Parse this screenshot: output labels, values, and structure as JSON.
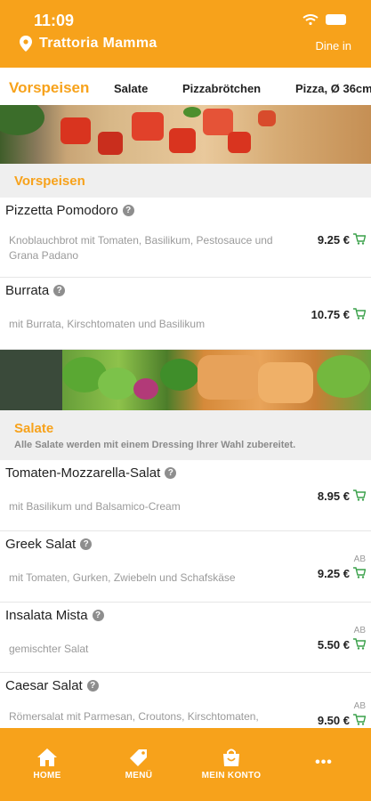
{
  "status_bar": {
    "time": "11:09"
  },
  "header": {
    "restaurant_name": "Trattoria Mamma",
    "mode": "Dine in"
  },
  "tabs": [
    {
      "label": "Vorspeisen",
      "active": true
    },
    {
      "label": "Salate",
      "active": false
    },
    {
      "label": "Pizzabrötchen",
      "active": false
    },
    {
      "label": "Pizza, Ø 36cm",
      "active": false
    }
  ],
  "sections": [
    {
      "title": "Vorspeisen",
      "note": "",
      "items": [
        {
          "name": "Pizzetta Pomodoro",
          "description": "Knoblauchbrot mit Tomaten, Basilikum, Pestosauce und Grana Padano",
          "price": "9.25 €",
          "ab": ""
        },
        {
          "name": "Burrata",
          "description": "mit Burrata, Kirschtomaten und Basilikum",
          "price": "10.75 €",
          "ab": ""
        }
      ]
    },
    {
      "title": "Salate",
      "note": "Alle Salate werden mit einem Dressing Ihrer Wahl zubereitet.",
      "items": [
        {
          "name": "Tomaten-Mozzarella-Salat",
          "description": "mit Basilikum und Balsamico-Cream",
          "price": "8.95 €",
          "ab": ""
        },
        {
          "name": "Greek Salat",
          "description": "mit Tomaten, Gurken, Zwiebeln und Schafskäse",
          "price": "9.25 €",
          "ab": "AB"
        },
        {
          "name": "Insalata Mista",
          "description": "gemischter Salat",
          "price": "5.50 €",
          "ab": "AB"
        },
        {
          "name": "Caesar Salat",
          "description": "Römersalat mit Parmesan, Croutons, Kirschtomaten,",
          "price": "9.50 €",
          "ab": "AB"
        }
      ]
    }
  ],
  "info_glyph": "?",
  "bottom_nav": [
    {
      "label": "HOME",
      "icon": "home-icon"
    },
    {
      "label": "MENÜ",
      "icon": "tag-icon"
    },
    {
      "label": "MEIN KONTO",
      "icon": "bag-icon"
    },
    {
      "label": "•••",
      "icon": "more-icon"
    }
  ],
  "colors": {
    "accent": "#f7a21b",
    "cart": "#3aa14a",
    "muted": "#9a9a9a"
  }
}
